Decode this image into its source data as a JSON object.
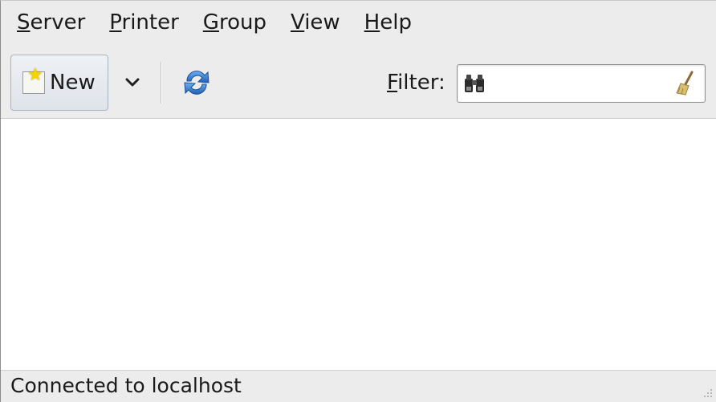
{
  "menubar": {
    "items": [
      {
        "mnemonic": "S",
        "rest": "erver"
      },
      {
        "mnemonic": "P",
        "rest": "rinter"
      },
      {
        "mnemonic": "G",
        "rest": "roup"
      },
      {
        "mnemonic": "V",
        "rest": "iew"
      },
      {
        "mnemonic": "H",
        "rest": "elp"
      }
    ]
  },
  "toolbar": {
    "new_label": "New",
    "new_icon": "new-document-icon",
    "dropdown_icon": "chevron-down-icon",
    "refresh_icon": "refresh-icon"
  },
  "filter": {
    "label_mnemonic": "F",
    "label_rest": "ilter:",
    "value": "",
    "find_icon": "binoculars-icon",
    "clear_icon": "broom-icon"
  },
  "status": {
    "text": "Connected to localhost"
  },
  "colors": {
    "chrome_bg": "#ececec",
    "content_bg": "#ffffff",
    "refresh_blue": "#2f74c8",
    "star_yellow": "#f4d400"
  }
}
